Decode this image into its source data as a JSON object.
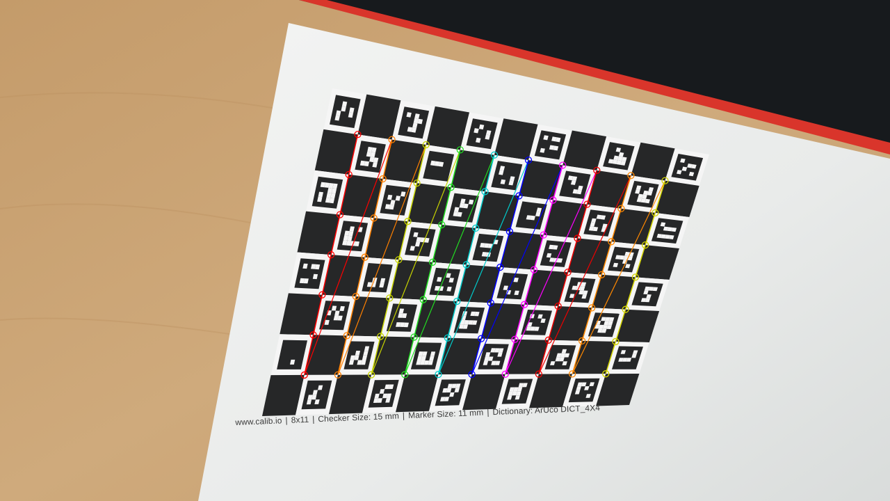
{
  "caption": {
    "site": "www.calib.io",
    "grid": "8x11",
    "checker": "Checker Size: 15 mm",
    "marker": "Marker Size: 11 mm",
    "dictionary": "Dictionary: ArUco DICT_4X4",
    "separator": "|"
  },
  "board": {
    "cols": 11,
    "rows": 8,
    "detected_corner_rows": 7,
    "detected_corner_cols": 10
  },
  "colors": {
    "wood": "#c9a67a",
    "mat_black": "#171a1d",
    "mat_red_edge": "#d9352b",
    "paper": "#eef0ef",
    "square": "#262728",
    "marker_white": "#f5f5f5",
    "corner_lines": [
      "#ff0000",
      "#ff8000",
      "#c8d400",
      "#22dd22",
      "#00cccc",
      "#0000ff",
      "#ff00ff",
      "#ee0000",
      "#ff8800",
      "#d4d400"
    ]
  }
}
